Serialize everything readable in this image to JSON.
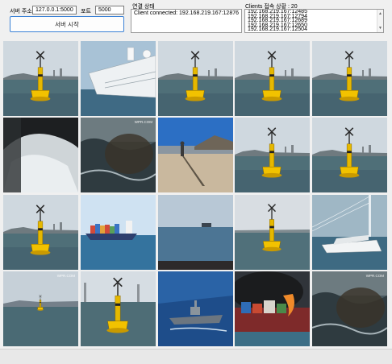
{
  "server": {
    "address_label": "서버 주소",
    "address_value": "127.0.0.1:5000",
    "port_label": "포트",
    "port_value": "5000",
    "start_button": "서버 시작"
  },
  "connection": {
    "label": "연결 상태",
    "status_text": "Client connected: 192.168.219.167:12876"
  },
  "clients": {
    "label": "Clients 접속 상황 : 20",
    "entries": [
      "192.168.219.167:12485",
      "192.168.219.167:12794",
      "192.168.219.167:12689",
      "192.168.219.167:12650",
      "192.168.219.167:12504"
    ]
  },
  "feeds": [
    {
      "type": "buoy"
    },
    {
      "type": "ship_deck"
    },
    {
      "type": "buoy"
    },
    {
      "type": "buoy"
    },
    {
      "type": "buoy"
    },
    {
      "type": "spray_dark",
      "watermark": ""
    },
    {
      "type": "waves_dark",
      "watermark": "WPR.COM"
    },
    {
      "type": "beach"
    },
    {
      "type": "buoy"
    },
    {
      "type": "buoy"
    },
    {
      "type": "buoy"
    },
    {
      "type": "container_ship"
    },
    {
      "type": "sea_horizon"
    },
    {
      "type": "buoy_close"
    },
    {
      "type": "bridge_cruise"
    },
    {
      "type": "sea_small_buoy",
      "watermark": "WPR.COM"
    },
    {
      "type": "buoy_tall"
    },
    {
      "type": "warship"
    },
    {
      "type": "ship_fire"
    },
    {
      "type": "waves_dark",
      "watermark": "WPR.COM"
    }
  ],
  "icons": {
    "scroll_up": "scroll-up-icon",
    "scroll_down": "scroll-down-icon"
  }
}
